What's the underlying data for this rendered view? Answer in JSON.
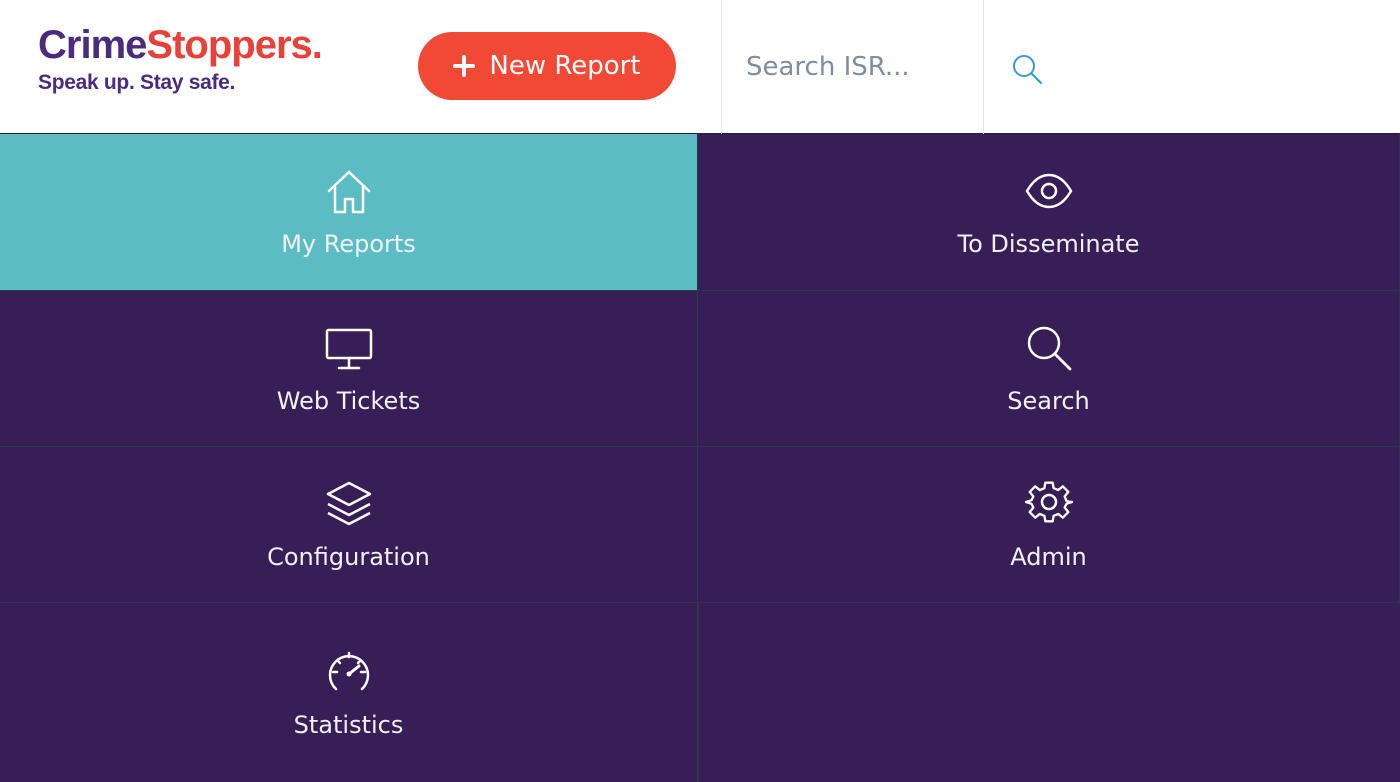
{
  "header": {
    "logo": {
      "part1": "Crime",
      "part2": "Stoppers.",
      "tagline": "Speak up. Stay safe."
    },
    "new_report_label": "New Report",
    "search": {
      "placeholder": "Search ISR..."
    }
  },
  "colors": {
    "brand_purple": "#371e57",
    "accent_red": "#f04a37",
    "active_teal": "#5cbcc4",
    "search_icon": "#3a9bd7"
  },
  "tiles": [
    {
      "label": "My Reports",
      "icon": "home-icon",
      "active": true
    },
    {
      "label": "To Disseminate",
      "icon": "eye-icon",
      "active": false
    },
    {
      "label": "Web Tickets",
      "icon": "monitor-icon",
      "active": false
    },
    {
      "label": "Search",
      "icon": "search-icon",
      "active": false
    },
    {
      "label": "Configuration",
      "icon": "layers-icon",
      "active": false
    },
    {
      "label": "Admin",
      "icon": "gear-icon",
      "active": false
    },
    {
      "label": "Statistics",
      "icon": "speedometer-icon",
      "active": false
    }
  ]
}
